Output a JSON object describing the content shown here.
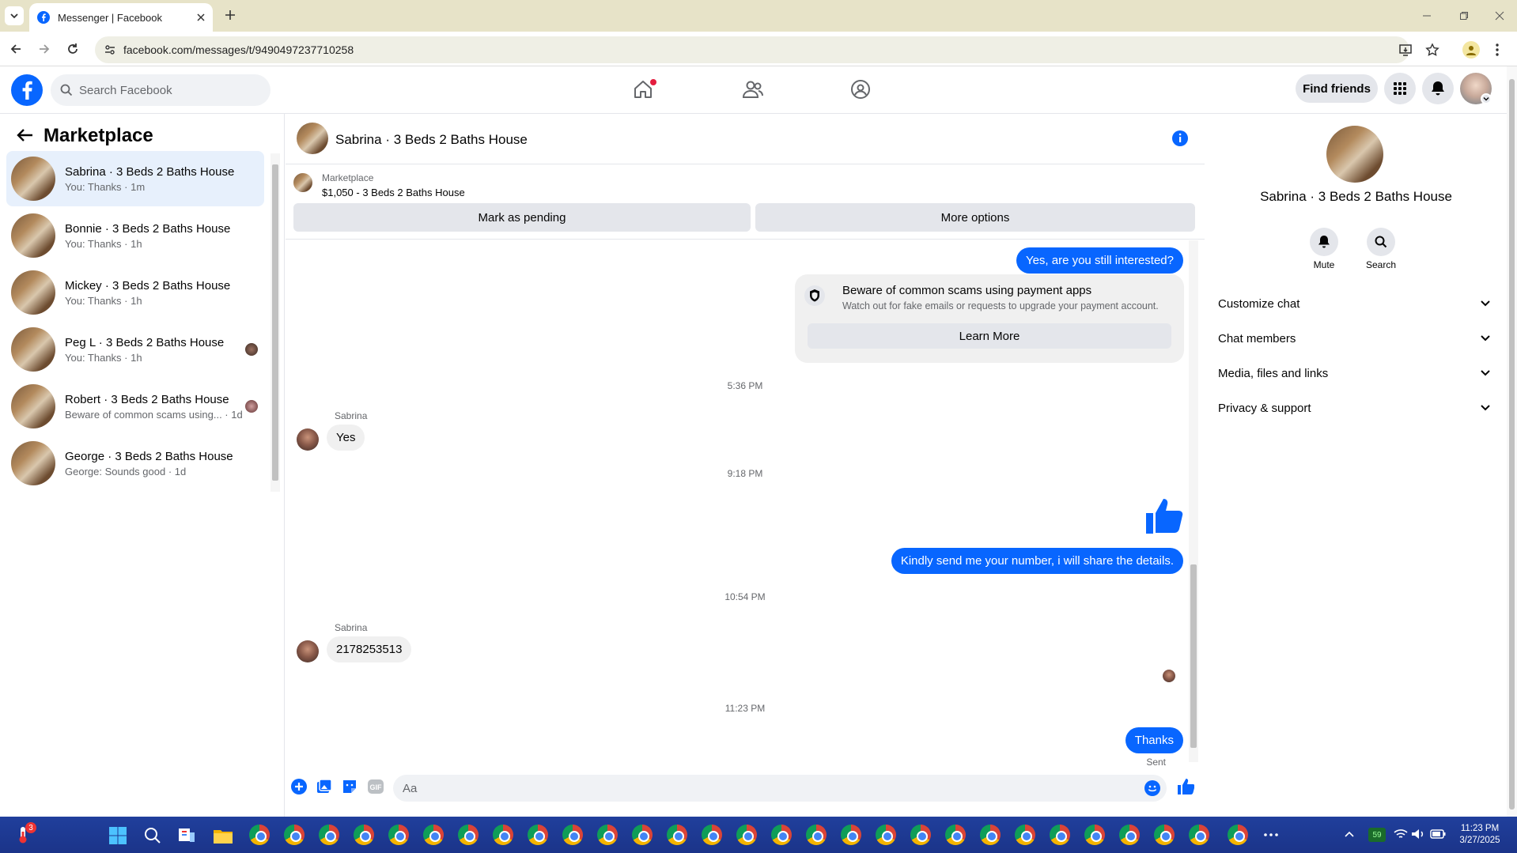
{
  "browser": {
    "tab_title": "Messenger | Facebook",
    "url": "facebook.com/messages/t/9490497237710258"
  },
  "header": {
    "search_placeholder": "Search Facebook",
    "find_friends": "Find friends"
  },
  "sidebar": {
    "title": "Marketplace",
    "items": [
      {
        "name": "Sabrina · 3 Beds 2 Baths House",
        "preview": "You: Thanks · 1m",
        "selected": true
      },
      {
        "name": "Bonnie · 3 Beds 2 Baths House",
        "preview": "You: Thanks · 1h"
      },
      {
        "name": "Mickey · 3 Beds 2 Baths House",
        "preview": "You: Thanks · 1h"
      },
      {
        "name": "Peg L · 3 Beds 2 Baths House",
        "preview": "You: Thanks · 1h"
      },
      {
        "name": "Robert · 3 Beds 2 Baths House",
        "preview": "Beware of common scams using... · 1d"
      },
      {
        "name": "George · 3 Beds 2 Baths House",
        "preview": "George: Sounds good · 1d"
      }
    ]
  },
  "chat": {
    "title": "Sabrina · 3 Beds 2 Baths House",
    "listing_label": "Marketplace",
    "listing_detail": "$1,050 - 3 Beds 2 Baths House",
    "mark_pending": "Mark as pending",
    "more_options": "More options",
    "msg_still_interested": "Yes, are you still interested?",
    "scam_title": "Beware of common scams using payment apps",
    "scam_body": "Watch out for fake emails or requests to upgrade your payment account.",
    "learn_more": "Learn More",
    "time1": "5:36 PM",
    "sender1": "Sabrina",
    "msg_yes": "Yes",
    "time2": "9:18 PM",
    "msg_kindly": "Kindly send me your number, i will share the details.",
    "time3": "10:54 PM",
    "sender2": "Sabrina",
    "msg_number": "2178253513",
    "time4": "11:23 PM",
    "msg_thanks": "Thanks",
    "sent_status": "Sent",
    "composer_placeholder": "Aa"
  },
  "right_panel": {
    "name": "Sabrina · 3 Beds 2 Baths House",
    "mute": "Mute",
    "search": "Search",
    "sections": [
      "Customize chat",
      "Chat members",
      "Media, files and links",
      "Privacy & support"
    ]
  },
  "taskbar": {
    "weather_badge": "3",
    "battery_label": "59",
    "time": "11:23 PM",
    "date": "3/27/2025"
  },
  "colors": {
    "fb_blue": "#0866ff",
    "selected_bg": "#e7f0fc"
  }
}
